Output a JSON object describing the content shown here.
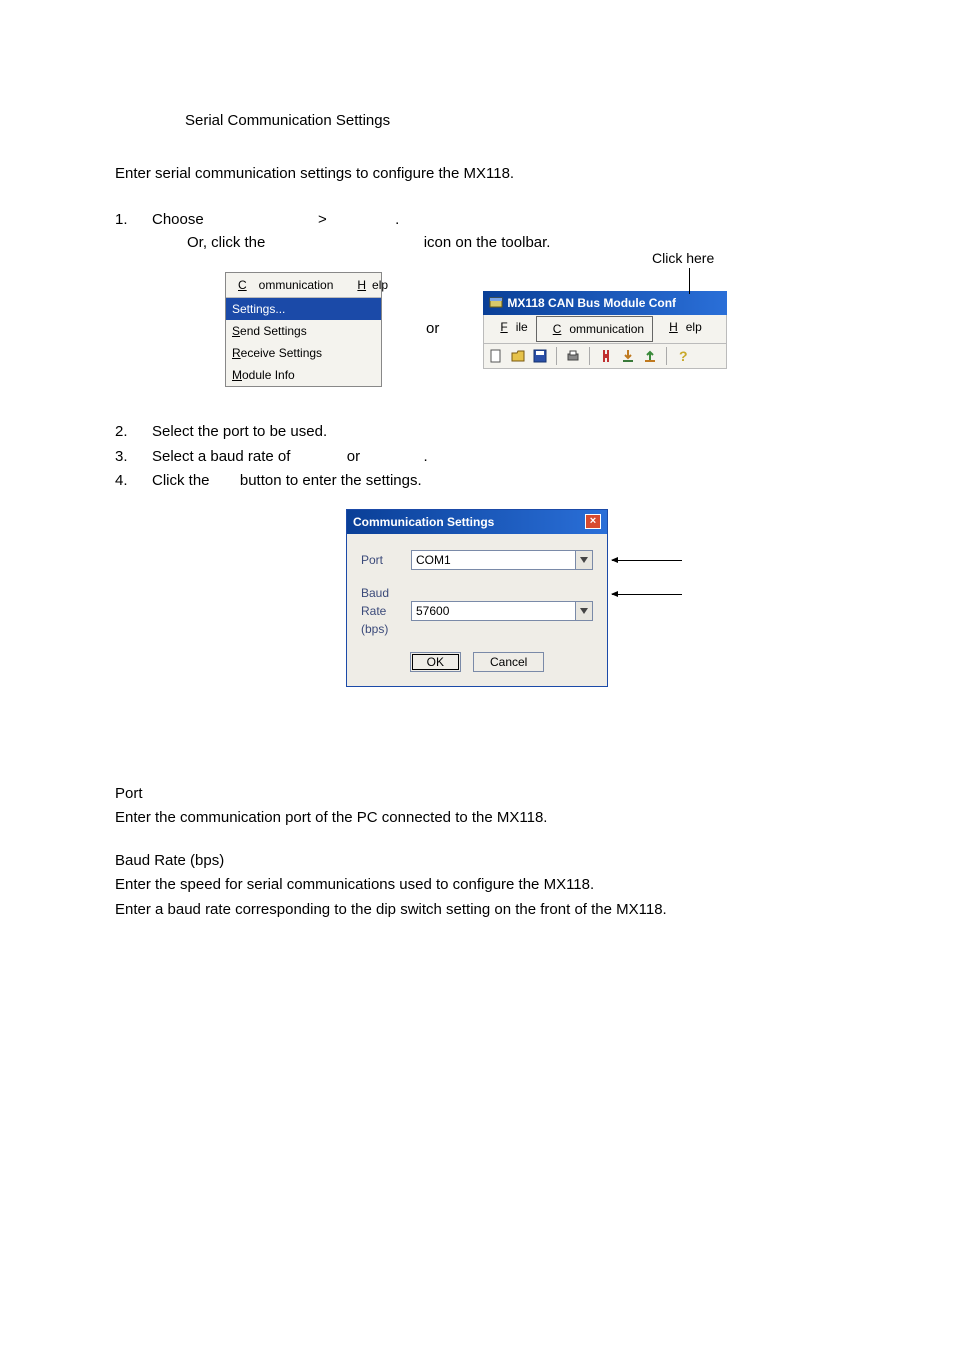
{
  "title": "Serial Communication Settings",
  "intro": "Enter serial communication settings to configure the MX118.",
  "steps": {
    "s1": {
      "num": "1.",
      "line1a": "Choose",
      "line1b": ">",
      "line1c": ".",
      "line2a": "Or, click the",
      "line2b": "icon on the toolbar."
    },
    "s2": {
      "num": "2.",
      "text": "Select the port to be used."
    },
    "s3": {
      "num": "3.",
      "a": "Select a baud rate of",
      "b": "or",
      "c": "."
    },
    "s4": {
      "num": "4.",
      "a": "Click the",
      "b": "button to enter the settings."
    }
  },
  "click_here": "Click here",
  "menu": {
    "comm": "Communication",
    "help": "Help",
    "settings": "Settings...",
    "send": "Send Settings",
    "receive": "Receive Settings",
    "module": "Module Info"
  },
  "or_text": "or",
  "titlebar_text": "MX118 CAN Bus Module Conf",
  "menubar": {
    "file": "File",
    "comm": "Communication",
    "help": "Help"
  },
  "dialog": {
    "title": "Communication Settings",
    "port_label": "Port",
    "port_value": "COM1",
    "baud_label": "Baud Rate (bps)",
    "baud_value": "57600",
    "ok": "OK",
    "cancel": "Cancel"
  },
  "desc": {
    "port_title": "Port",
    "port_text": "Enter the communication port of the PC connected to the MX118.",
    "baud_title": "Baud Rate (bps)",
    "baud_line1": "Enter the speed for serial communications used to configure the MX118.",
    "baud_line2": "Enter a baud rate corresponding to the dip switch setting on the front of the MX118."
  }
}
